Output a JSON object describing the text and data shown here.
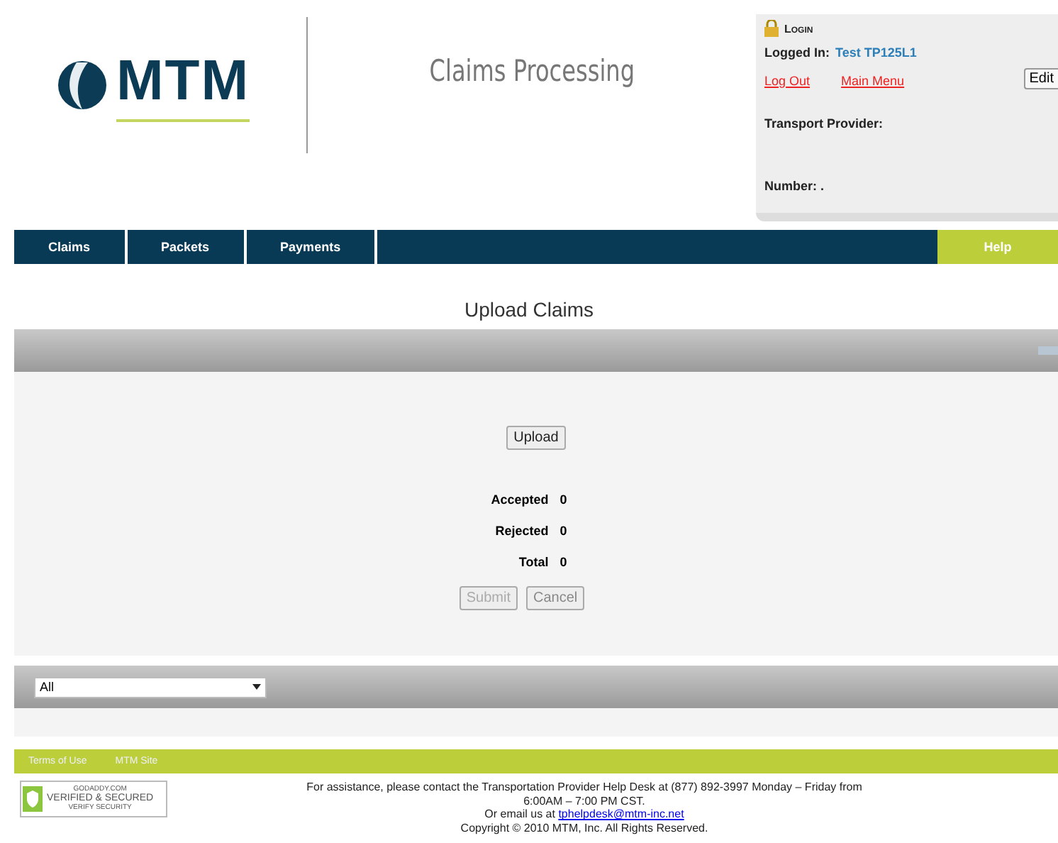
{
  "header": {
    "logo": "MTM",
    "app_title": "Claims Processing"
  },
  "login": {
    "title": "Login",
    "logged_in_label": "Logged In:",
    "user": "Test TP125L1",
    "links": [
      "Log Out",
      "Main Menu"
    ],
    "edit_button": "Edit",
    "transport_provider_label": "Transport Provider:",
    "number_label": "Number: ."
  },
  "nav": {
    "items": [
      {
        "label": "Claims",
        "kind": "tab"
      },
      {
        "label": "Packets",
        "kind": "tab"
      },
      {
        "label": "Payments",
        "kind": "tab"
      },
      {
        "label": "Help",
        "kind": "help"
      }
    ]
  },
  "page_title": "Upload Claims",
  "upload_button": "Upload",
  "counts": [
    {
      "label": "Accepted",
      "value": "0"
    },
    {
      "label": "Rejected",
      "value": "0"
    },
    {
      "label": "Total",
      "value": "0"
    }
  ],
  "actions": [
    {
      "label": "Submit",
      "disabled": true
    },
    {
      "label": "Cancel",
      "disabled": false
    }
  ],
  "filter": {
    "value": "All"
  },
  "footer": {
    "links": [
      "Terms of Use",
      "MTM Site"
    ],
    "seal": [
      "GODADDY.COM",
      "VERIFIED & SECURED",
      "VERIFY SECURITY"
    ],
    "assistance": "For assistance, please contact the Transportation Provider Help Desk at (877) 892-3997 Monday – Friday from 6:00AM – 7:00 PM CST.",
    "email_prefix": "Or email us at",
    "email": "tphelpdesk@mtm-inc.net",
    "copyright": "Copyright © 2010 MTM, Inc. All Rights Reserved."
  }
}
